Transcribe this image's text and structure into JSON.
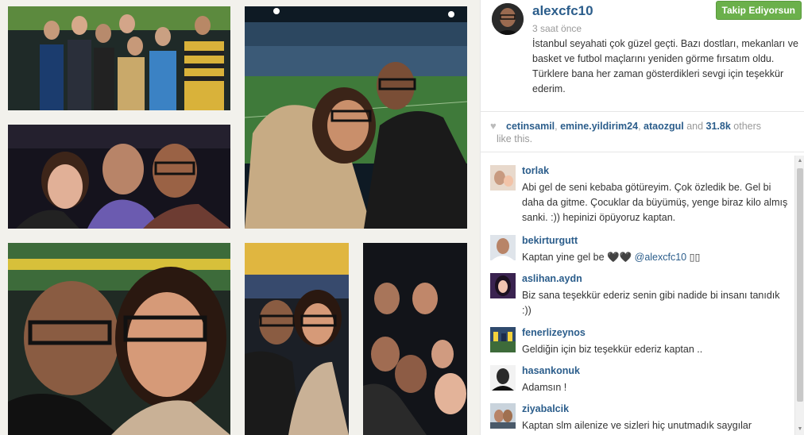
{
  "post": {
    "username": "alexcfc10",
    "follow_label": "Takip Ediyorsun",
    "time": "3 saat önce",
    "caption": "İstanbul seyahati çok güzel geçti. Bazı dostları, mekanları ve basket ve futbol maçlarını yeniden görme fırsatım oldu. Türklere bana her zaman gösterdikleri sevgi için teşekkür ederim."
  },
  "likes": {
    "user1": "cetinsamil",
    "sep1": ", ",
    "user2": "emine.yildirim24",
    "sep2": ", ",
    "user3": "ataozgul",
    "and_text": " and ",
    "count": "31.8k",
    "others_text": " others",
    "tail": "like this."
  },
  "comments": [
    {
      "user": "torlak",
      "text": "Abi gel de seni kebaba götüreyim. Çok özledik be. Gel bi daha da gitme. Çocuklar da büyümüş, yenge biraz kilo almış sanki. :)) hepinizi öpüyoruz kaptan."
    },
    {
      "user": "bekirturgutt",
      "text": "Kaptan yine gel be 🖤🖤 ",
      "mention": "@alexcfc10",
      "tail": " ▯▯"
    },
    {
      "user": "aslihan.aydn",
      "text": "Biz sana teşekkür ederiz senin gibi nadide bi insanı tanıdık :))"
    },
    {
      "user": "fenerlizeynos",
      "text": "Geldiğin için biz teşekkür ederiz kaptan .."
    },
    {
      "user": "hasankonuk",
      "text": "Adamsın !"
    },
    {
      "user": "ziyabalcik",
      "text": "Kaptan slm ailenize ve sizleri hiç unutmadık saygılar"
    }
  ],
  "icons": {
    "heart": "heart-icon",
    "scroll_up": "scroll-up-arrow-icon",
    "scroll_down": "scroll-down-arrow-icon"
  },
  "colors": {
    "link": "#2b5d8b",
    "follow_bg": "#6bb04b",
    "collage_bg": "#f2f1ec"
  }
}
